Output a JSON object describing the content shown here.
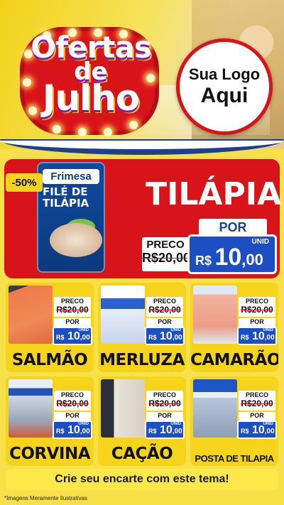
{
  "header": {
    "title_line1": "Ofertas",
    "title_line2": "de",
    "title_line3": "Julho",
    "logo_line1": "Sua Logo",
    "logo_line2": "Aqui"
  },
  "hero": {
    "discount_badge": "-50%",
    "package_brand": "Frimesa",
    "package_name": "FILÉ DE TILÁPIA",
    "product_title": "TILÁPIA",
    "preco_label": "PRECO",
    "old_price": "R$20,00",
    "por_label": "POR",
    "unid_label": "UNID",
    "currency": "R$",
    "price_int": "10",
    "price_dec": ",00"
  },
  "products": [
    {
      "name": "SALMÃO",
      "preco_label": "PRECO",
      "old_price": "R$20,00",
      "por_label": "POR",
      "unid_label": "UNID",
      "currency": "R$",
      "price_int": "10",
      "price_dec": ",00"
    },
    {
      "name": "MERLUZA",
      "preco_label": "PRECO",
      "old_price": "R$20,00",
      "por_label": "POR",
      "unid_label": "UNID",
      "currency": "R$",
      "price_int": "10",
      "price_dec": ",00"
    },
    {
      "name": "CAMARÃO",
      "preco_label": "PRECO",
      "old_price": "R$20,00",
      "por_label": "POR",
      "unid_label": "UNID",
      "currency": "R$",
      "price_int": "10",
      "price_dec": ",00"
    },
    {
      "name": "CORVINA",
      "preco_label": "PRECO",
      "old_price": "R$20,00",
      "por_label": "POR",
      "unid_label": "UNID",
      "currency": "R$",
      "price_int": "10",
      "price_dec": ",00"
    },
    {
      "name": "CAÇÃO",
      "preco_label": "PRECO",
      "old_price": "R$20,00",
      "por_label": "POR",
      "unid_label": "UNID",
      "currency": "R$",
      "price_int": "10",
      "price_dec": ",00"
    },
    {
      "name": "POSTA DE TILAPIA",
      "preco_label": "PRECO",
      "old_price": "R$20,00",
      "por_label": "POR",
      "unid_label": "UNID",
      "currency": "R$",
      "price_int": "10",
      "price_dec": ",00"
    }
  ],
  "cta_text": "Crie seu encarte com este tema!",
  "footer_note": "*Imagens Meramente Ilustrativas",
  "colors": {
    "red": "#d8141b",
    "yellow": "#f6d41b",
    "blue": "#1d4fc4",
    "navy": "#1c3f8f"
  }
}
